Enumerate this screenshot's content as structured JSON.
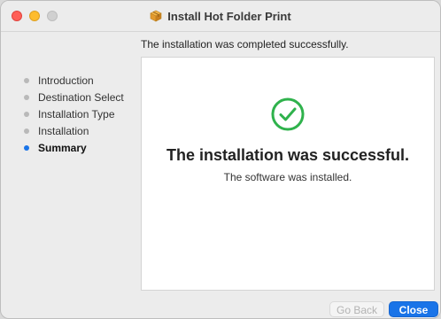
{
  "window": {
    "title": "Install Hot Folder Print",
    "subtitle": "The installation was completed successfully."
  },
  "sidebar": {
    "steps": [
      {
        "label": "Introduction",
        "active": false
      },
      {
        "label": "Destination Select",
        "active": false
      },
      {
        "label": "Installation Type",
        "active": false
      },
      {
        "label": "Installation",
        "active": false
      },
      {
        "label": "Summary",
        "active": true
      }
    ]
  },
  "main": {
    "headline": "The installation was successful.",
    "detail": "The software was installed.",
    "status_icon": "checkmark-circle-icon"
  },
  "buttons": {
    "back_label": "Go Back",
    "close_label": "Close"
  },
  "colors": {
    "accent": "#1a74e8",
    "success": "#2fb24c",
    "close_dot": "#ff5f57",
    "minimize_dot": "#febc2e"
  }
}
